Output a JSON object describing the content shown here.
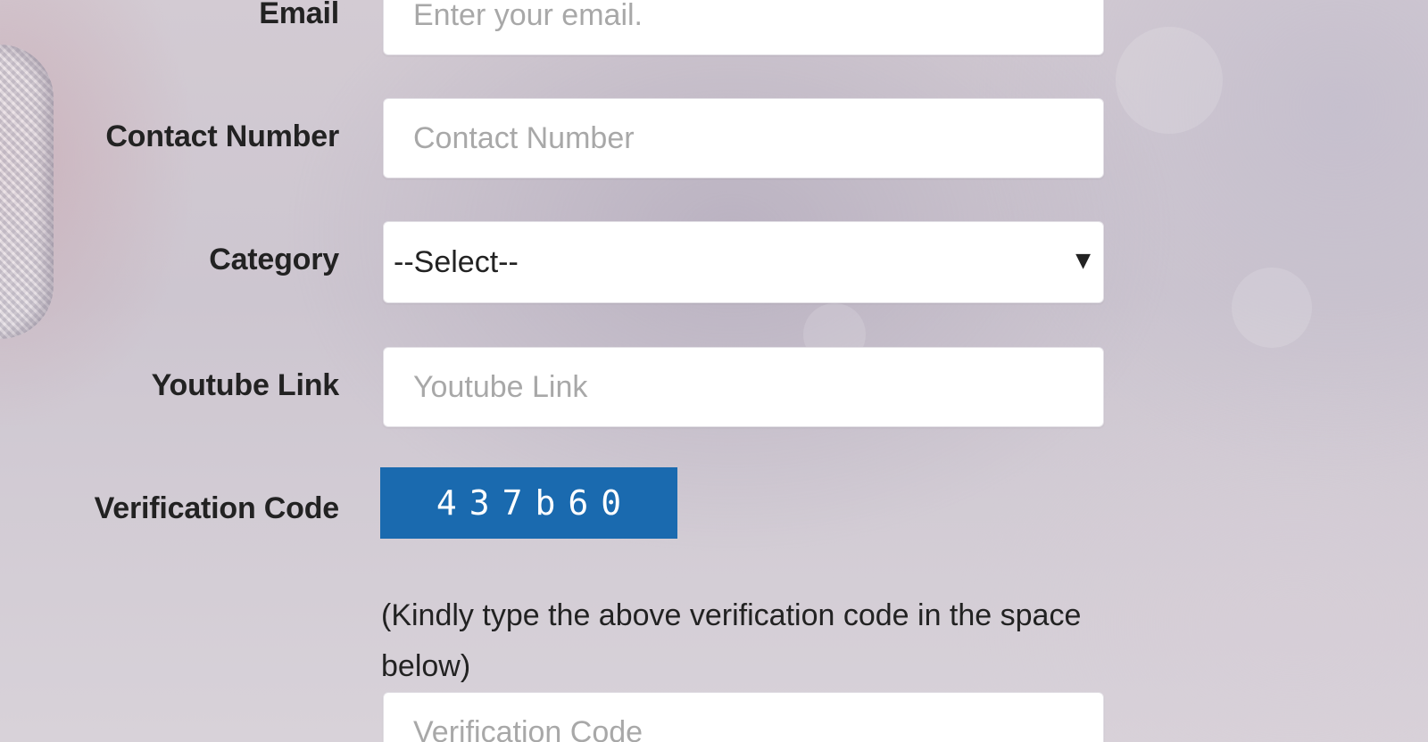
{
  "form": {
    "email": {
      "label": "Email",
      "placeholder": "Enter your email."
    },
    "contact": {
      "label": "Contact Number",
      "placeholder": "Contact Number"
    },
    "category": {
      "label": "Category",
      "selected": "--Select--"
    },
    "youtube": {
      "label": "Youtube Link",
      "placeholder": "Youtube Link"
    },
    "verification": {
      "label": "Verification Code",
      "code": "437b60",
      "hint": "(Kindly type the above verification code in the space below)",
      "placeholder": "Verification Code"
    }
  },
  "colors": {
    "captcha_bg": "#1a6aaf",
    "label_text": "#222222",
    "placeholder_text": "#a8a8a8"
  },
  "icons": {
    "select_caret": "chevron-down-icon"
  }
}
